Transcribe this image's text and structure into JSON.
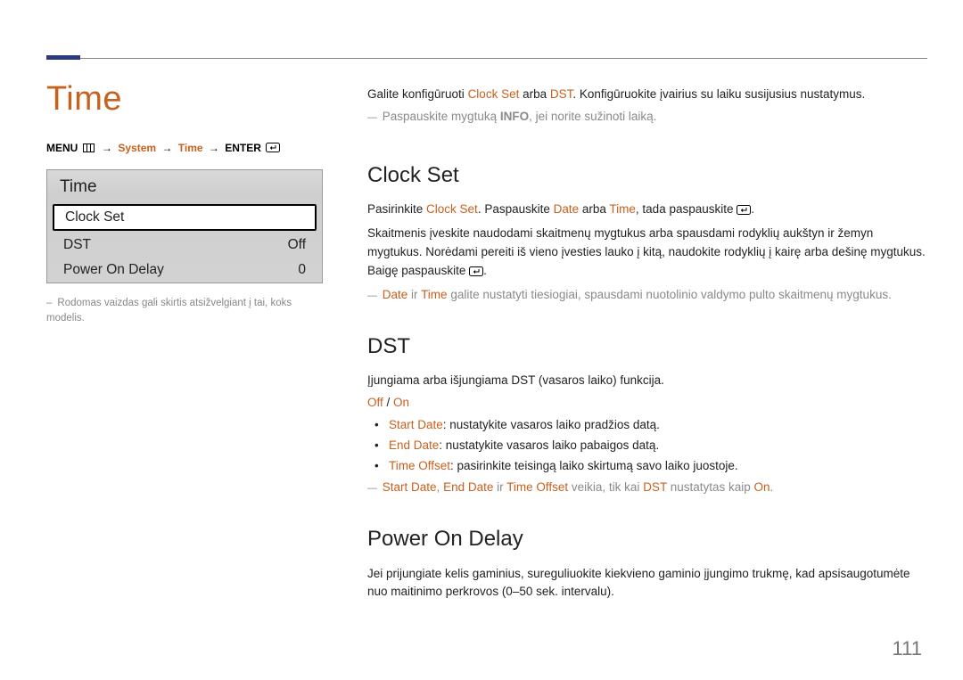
{
  "page_number": "111",
  "left": {
    "heading": "Time",
    "breadcrumb": {
      "menu": "MENU",
      "system": "System",
      "time": "Time",
      "enter": "ENTER"
    },
    "panel": {
      "title": "Time",
      "rows": [
        {
          "label": "Clock Set",
          "value": "",
          "selected": true
        },
        {
          "label": "DST",
          "value": "Off",
          "selected": false
        },
        {
          "label": "Power On Delay",
          "value": "0",
          "selected": false
        }
      ]
    },
    "caption": "Rodomas vaizdas gali skirtis atsižvelgiant į tai, koks modelis."
  },
  "right": {
    "intro_parts": {
      "a": "Galite konfigūruoti ",
      "clockset": "Clock Set",
      "b": " arba ",
      "dst": "DST",
      "c": ". Konfigūruokite įvairius su laiku susijusius nustatymus."
    },
    "intro_note_parts": {
      "a": "Paspauskite mygtuką ",
      "info": "INFO",
      "b": ", jei norite sužinoti laiką."
    },
    "clockset": {
      "heading": "Clock Set",
      "p1": {
        "a": "Pasirinkite ",
        "cs": "Clock Set",
        "b": ". Paspauskite ",
        "date": "Date",
        "c": " arba ",
        "time": "Time",
        "d": ", tada paspauskite "
      },
      "p2": "Skaitmenis įveskite naudodami skaitmenų mygtukus arba spausdami rodyklių aukštyn ir žemyn mygtukus. Norėdami pereiti iš vieno įvesties lauko į kitą, naudokite rodyklių į kairę arba dešinę mygtukus. Baigę paspauskite ",
      "note": {
        "date": "Date",
        "mid": " ir ",
        "time": "Time",
        "rest": " galite nustatyti tiesiogiai, spausdami nuotolinio valdymo pulto skaitmenų mygtukus."
      }
    },
    "dst": {
      "heading": "DST",
      "intro": "Įjungiama arba išjungiama DST (vasaros laiko) funkcija.",
      "off": "Off",
      "slash": " / ",
      "on": "On",
      "bullets": {
        "b1_key": "Start Date",
        "b1_text": ": nustatykite vasaros laiko pradžios datą.",
        "b2_key": "End Date",
        "b2_text": ": nustatykite vasaros laiko pabaigos datą.",
        "b3_key": "Time Offset",
        "b3_text": ": pasirinkite teisingą laiko skirtumą savo laiko juostoje."
      },
      "note": {
        "k1": "Start Date",
        "c1": ", ",
        "k2": "End Date",
        "c2": " ir ",
        "k3": "Time Offset",
        "rest1": " veikia, tik kai ",
        "dst": "DST",
        "rest2": " nustatytas kaip ",
        "on": "On",
        "dot": "."
      }
    },
    "pod": {
      "heading": "Power On Delay",
      "text": "Jei prijungiate kelis gaminius, sureguliuokite kiekvieno gaminio įjungimo trukmę, kad apsisaugotumėte nuo maitinimo perkrovos (0–50 sek. intervalu)."
    }
  }
}
